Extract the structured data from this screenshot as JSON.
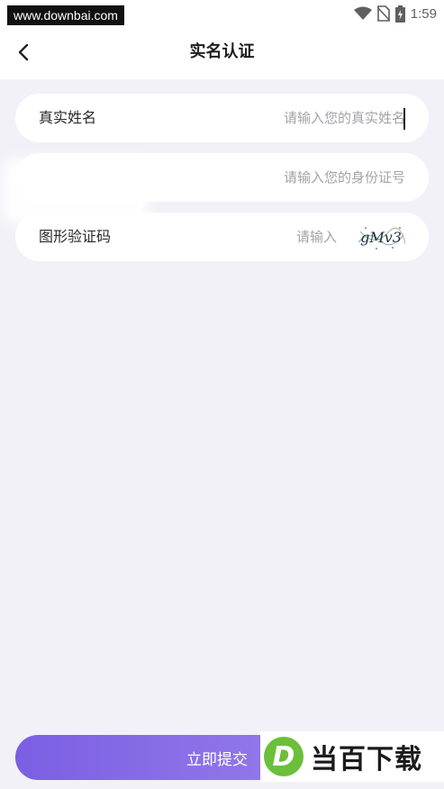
{
  "status_bar": {
    "watermark_url": "www.downbai.com",
    "time": "1:59",
    "icons": [
      "wifi-icon",
      "no-sim-icon",
      "battery-charging-icon"
    ]
  },
  "header": {
    "title": "实名认证",
    "back_icon": "chevron-left-icon"
  },
  "form": {
    "name_field": {
      "label": "真实姓名",
      "placeholder": "请输入您的真实姓名"
    },
    "id_field": {
      "label": "",
      "placeholder": "请输入您的身份证号"
    },
    "captcha_field": {
      "label": "图形验证码",
      "placeholder": "请输入",
      "captcha_text": "gMv3"
    }
  },
  "submit": {
    "label": "立即提交"
  },
  "brand_watermark": {
    "logo_letter": "D",
    "text": "当百下载"
  },
  "colors": {
    "background": "#f2f1f7",
    "accent_start": "#7b5fe3",
    "accent_end": "#9f86ee",
    "brand_green": "#6cbf3a"
  }
}
